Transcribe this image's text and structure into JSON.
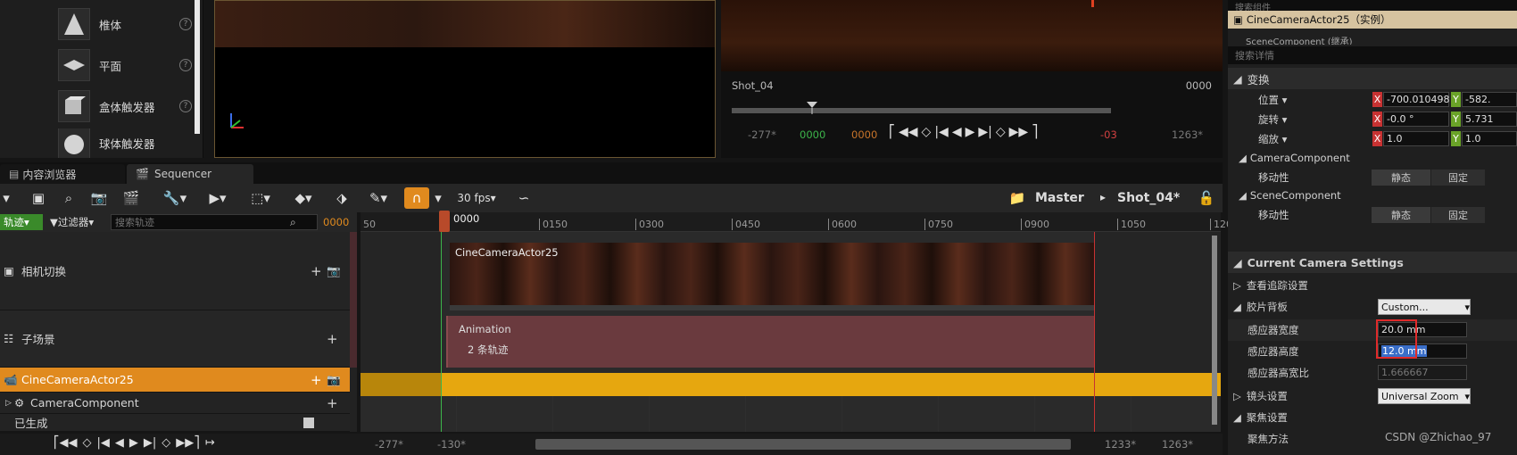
{
  "place_panel": {
    "items": [
      {
        "label": "椎体",
        "icon": "cone-icon"
      },
      {
        "label": "平面",
        "icon": "plane-icon"
      },
      {
        "label": "盒体触发器",
        "icon": "box-trigger-icon"
      },
      {
        "label": "球体触发器",
        "icon": "sphere-trigger-icon"
      }
    ],
    "help": "?"
  },
  "viewport2": {
    "shot_label": "Shot_04",
    "frame_label": "0000"
  },
  "transport_top": {
    "start": "-277*",
    "in": "0000",
    "current": "0000",
    "out": "1263*",
    "end_marker": "-03"
  },
  "tabs": [
    {
      "label": "内容浏览器",
      "icon": "content-browser-icon"
    },
    {
      "label": "Sequencer",
      "icon": "sequencer-icon"
    }
  ],
  "toolbar": {
    "fps": "30 fps",
    "breadcrumb": {
      "root": "Master",
      "sep": "▸",
      "shot": "Shot_04*"
    }
  },
  "filterbar": {
    "track_btn": "轨迹",
    "filter_btn": "过滤器",
    "search_placeholder": "搜索轨迹",
    "frame": "0000"
  },
  "ruler": {
    "playhead": "0000",
    "ticks": [
      "50",
      "0150",
      "0300",
      "0450",
      "0600",
      "0750",
      "0900",
      "1050",
      "120"
    ]
  },
  "tracks": [
    {
      "label": "相机切换",
      "icon": "camera-cut-icon"
    },
    {
      "label": "子场景",
      "icon": "subscene-icon"
    },
    {
      "label": "CineCameraActor25",
      "icon": "cine-camera-icon"
    },
    {
      "label": "CameraComponent",
      "icon": "camera-component-icon"
    },
    {
      "label": "已生成",
      "icon": ""
    }
  ],
  "sections": {
    "camera_cut_label": "CineCameraActor25",
    "anim_title": "Animation",
    "anim_sub": "2 条轨迹"
  },
  "bottombar": {
    "start": "-277*",
    "view_start": "-130*",
    "view_end": "1233*",
    "end": "1263*"
  },
  "details": {
    "search_components": "搜索组件",
    "instance": "CineCameraActor25（实例）",
    "scene_component": "SceneComponent (继承)",
    "search_details": "搜索详情",
    "transform": "变换",
    "location": {
      "label": "位置",
      "x": "-700.010498",
      "y": "-582."
    },
    "rotation": {
      "label": "旋转",
      "x": "-0.0 °",
      "y": "5.731"
    },
    "scale": {
      "label": "缩放",
      "x": "1.0",
      "y": "1.0"
    },
    "camera_component": "CameraComponent",
    "mobility": "移动性",
    "static": "静态",
    "fixed": "固定",
    "scene_component_cat": "SceneComponent",
    "current_camera_settings": "Current Camera Settings",
    "lookat": "查看追踪设置",
    "filmback": "胶片背板",
    "filmback_value": "Custom...",
    "sensor_width": {
      "label": "感应器宽度",
      "value": "20.0 mm"
    },
    "sensor_height": {
      "label": "感应器高度",
      "value": "12.0 mm"
    },
    "aspect": {
      "label": "感应器高宽比",
      "value": "1.666667"
    },
    "lens": "镜头设置",
    "lens_value": "Universal Zoom",
    "focus": "聚焦设置",
    "focus_method": "聚焦方法",
    "watermark": "CSDN @Zhichao_97"
  },
  "colors": {
    "accent": "#e08a1e",
    "highlight_box": "#e02a2a",
    "anim_section": "#6a3a3e",
    "actor_row": "#e6a70f"
  }
}
